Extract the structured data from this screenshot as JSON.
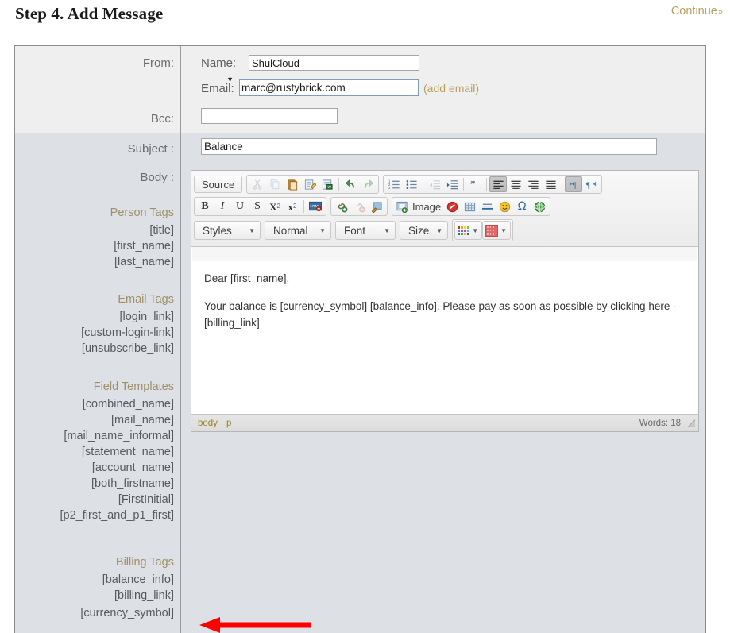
{
  "header": {
    "title": "Step 4. Add Message",
    "continue_label": "Continue",
    "continue_chevron": "»"
  },
  "colors": {
    "accent_gold": "#b9a05c",
    "tag_header": "#9f8f6a",
    "tag_text": "#555a5e",
    "label_text": "#6d6d6d",
    "band_top_bg": "#efefef",
    "band_bottom_bg": "#dde1e5",
    "frame_border": "#8c8c8c",
    "annotation_arrow": "#fe0000",
    "editor_path": "#9a8324"
  },
  "form": {
    "rows": {
      "from_label": "From:",
      "bcc_label": "Bcc:",
      "subject_label": "Subject :",
      "body_label": "Body :"
    },
    "from": {
      "name_label": "Name:",
      "name_value": "ShulCloud",
      "email_label": "Email:",
      "email_selected": "marc@rustybrick.com",
      "email_options": [
        "marc@rustybrick.com"
      ],
      "add_email_label": "(add email)"
    },
    "bcc": {
      "value": "",
      "placeholder": ""
    },
    "subject": {
      "value": "Balance",
      "placeholder": ""
    }
  },
  "tag_groups": [
    {
      "heading": "Person Tags",
      "tags": [
        "[title]",
        "[first_name]",
        "[last_name]"
      ]
    },
    {
      "heading": "Email Tags",
      "tags": [
        "[login_link]",
        "[custom-login-link]",
        "[unsubscribe_link]"
      ]
    },
    {
      "heading": "Field Templates",
      "tags": [
        "[combined_name]",
        "[mail_name]",
        "[mail_name_informal]",
        "[statement_name]",
        "[account_name]",
        "[both_firstname]",
        "[FirstInitial]",
        "[p2_first_and_p1_first]"
      ]
    },
    {
      "heading": "Billing Tags",
      "tags": [
        "[balance_info]",
        "[billing_link]",
        "[currency_symbol]"
      ]
    }
  ],
  "editor": {
    "toolbar": {
      "source_label": "Source",
      "row1_icons": [
        "cut-icon",
        "copy-icon",
        "paste-icon",
        "paste-text-icon",
        "paste-from-word-icon",
        "undo-icon",
        "redo-icon",
        "numbered-list-icon",
        "bulleted-list-icon",
        "decrease-indent-icon",
        "increase-indent-icon",
        "blockquote-icon",
        "align-left-icon",
        "align-center-icon",
        "align-right-icon",
        "justify-icon",
        "text-direction-ltr-icon",
        "text-direction-rtl-icon"
      ],
      "row2_icons": [
        "bold-icon",
        "italic-icon",
        "underline-icon",
        "strikethrough-icon",
        "subscript-icon",
        "superscript-icon",
        "remove-format-icon",
        "link-icon",
        "unlink-icon",
        "anchor-icon",
        "image-icon",
        "flash-icon",
        "table-icon",
        "horizontal-rule-icon",
        "smiley-icon",
        "special-character-icon",
        "iframe-icon"
      ],
      "bold_label": "B",
      "italic_label": "I",
      "underline_label": "U",
      "strike_label": "S",
      "subscript_label": "X",
      "subscript_sub": "2",
      "superscript_label": "x",
      "superscript_sup": "2",
      "image_label": "Image",
      "styles_label": "Styles",
      "format_label": "Normal",
      "font_label": "Font",
      "size_label": "Size",
      "text_color_name": "text-color-icon",
      "bg_color_name": "background-color-icon",
      "active_button": "align-left-icon"
    },
    "content": {
      "line1": "Dear [first_name],",
      "line2": "Your balance is [currency_symbol] [balance_info]. Please pay as soon as possible by clicking here - [billing_link]"
    },
    "footer": {
      "path": [
        "body",
        "p"
      ],
      "word_count": "Words: 18",
      "resize_handle": "resize-handle-icon"
    }
  },
  "annotation": {
    "arrow_name": "red-arrow-annotation",
    "points_at": "[balance_info]"
  }
}
